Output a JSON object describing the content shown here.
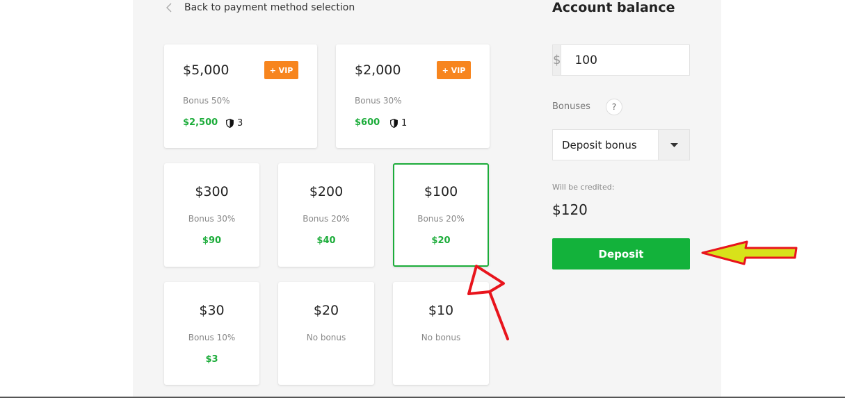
{
  "back_link": {
    "label": "Back to payment method selection",
    "icon": "chevron-left-icon"
  },
  "vip_packages": [
    {
      "amount": "$5,000",
      "badge": "+ VIP",
      "bonus_label": "Bonus 50%",
      "bonus_value": "$2,500",
      "shield_count": "3"
    },
    {
      "amount": "$2,000",
      "badge": "+ VIP",
      "bonus_label": "Bonus 30%",
      "bonus_value": "$600",
      "shield_count": "1"
    }
  ],
  "packages": [
    {
      "amount": "$300",
      "bonus_label": "Bonus 30%",
      "bonus_value": "$90"
    },
    {
      "amount": "$200",
      "bonus_label": "Bonus 20%",
      "bonus_value": "$40"
    },
    {
      "amount": "$100",
      "bonus_label": "Bonus 20%",
      "bonus_value": "$20",
      "selected": true
    },
    {
      "amount": "$30",
      "bonus_label": "Bonus 10%",
      "bonus_value": "$3"
    },
    {
      "amount": "$20",
      "bonus_label": "No bonus",
      "bonus_value": ""
    },
    {
      "amount": "$10",
      "bonus_label": "No bonus",
      "bonus_value": ""
    }
  ],
  "sidebar": {
    "title": "Account balance",
    "currency_symbol": "$",
    "amount_value": "100",
    "bonuses_label": "Bonuses",
    "help_symbol": "?",
    "bonus_select_value": "Deposit bonus",
    "credited_label": "Will be credited:",
    "credited_value": "$120",
    "deposit_label": "Deposit"
  },
  "colors": {
    "accent_green": "#13b23b",
    "vip_orange": "#f7851e",
    "annotation_red": "#e8141c",
    "annotation_yellow": "#d8e21a"
  }
}
